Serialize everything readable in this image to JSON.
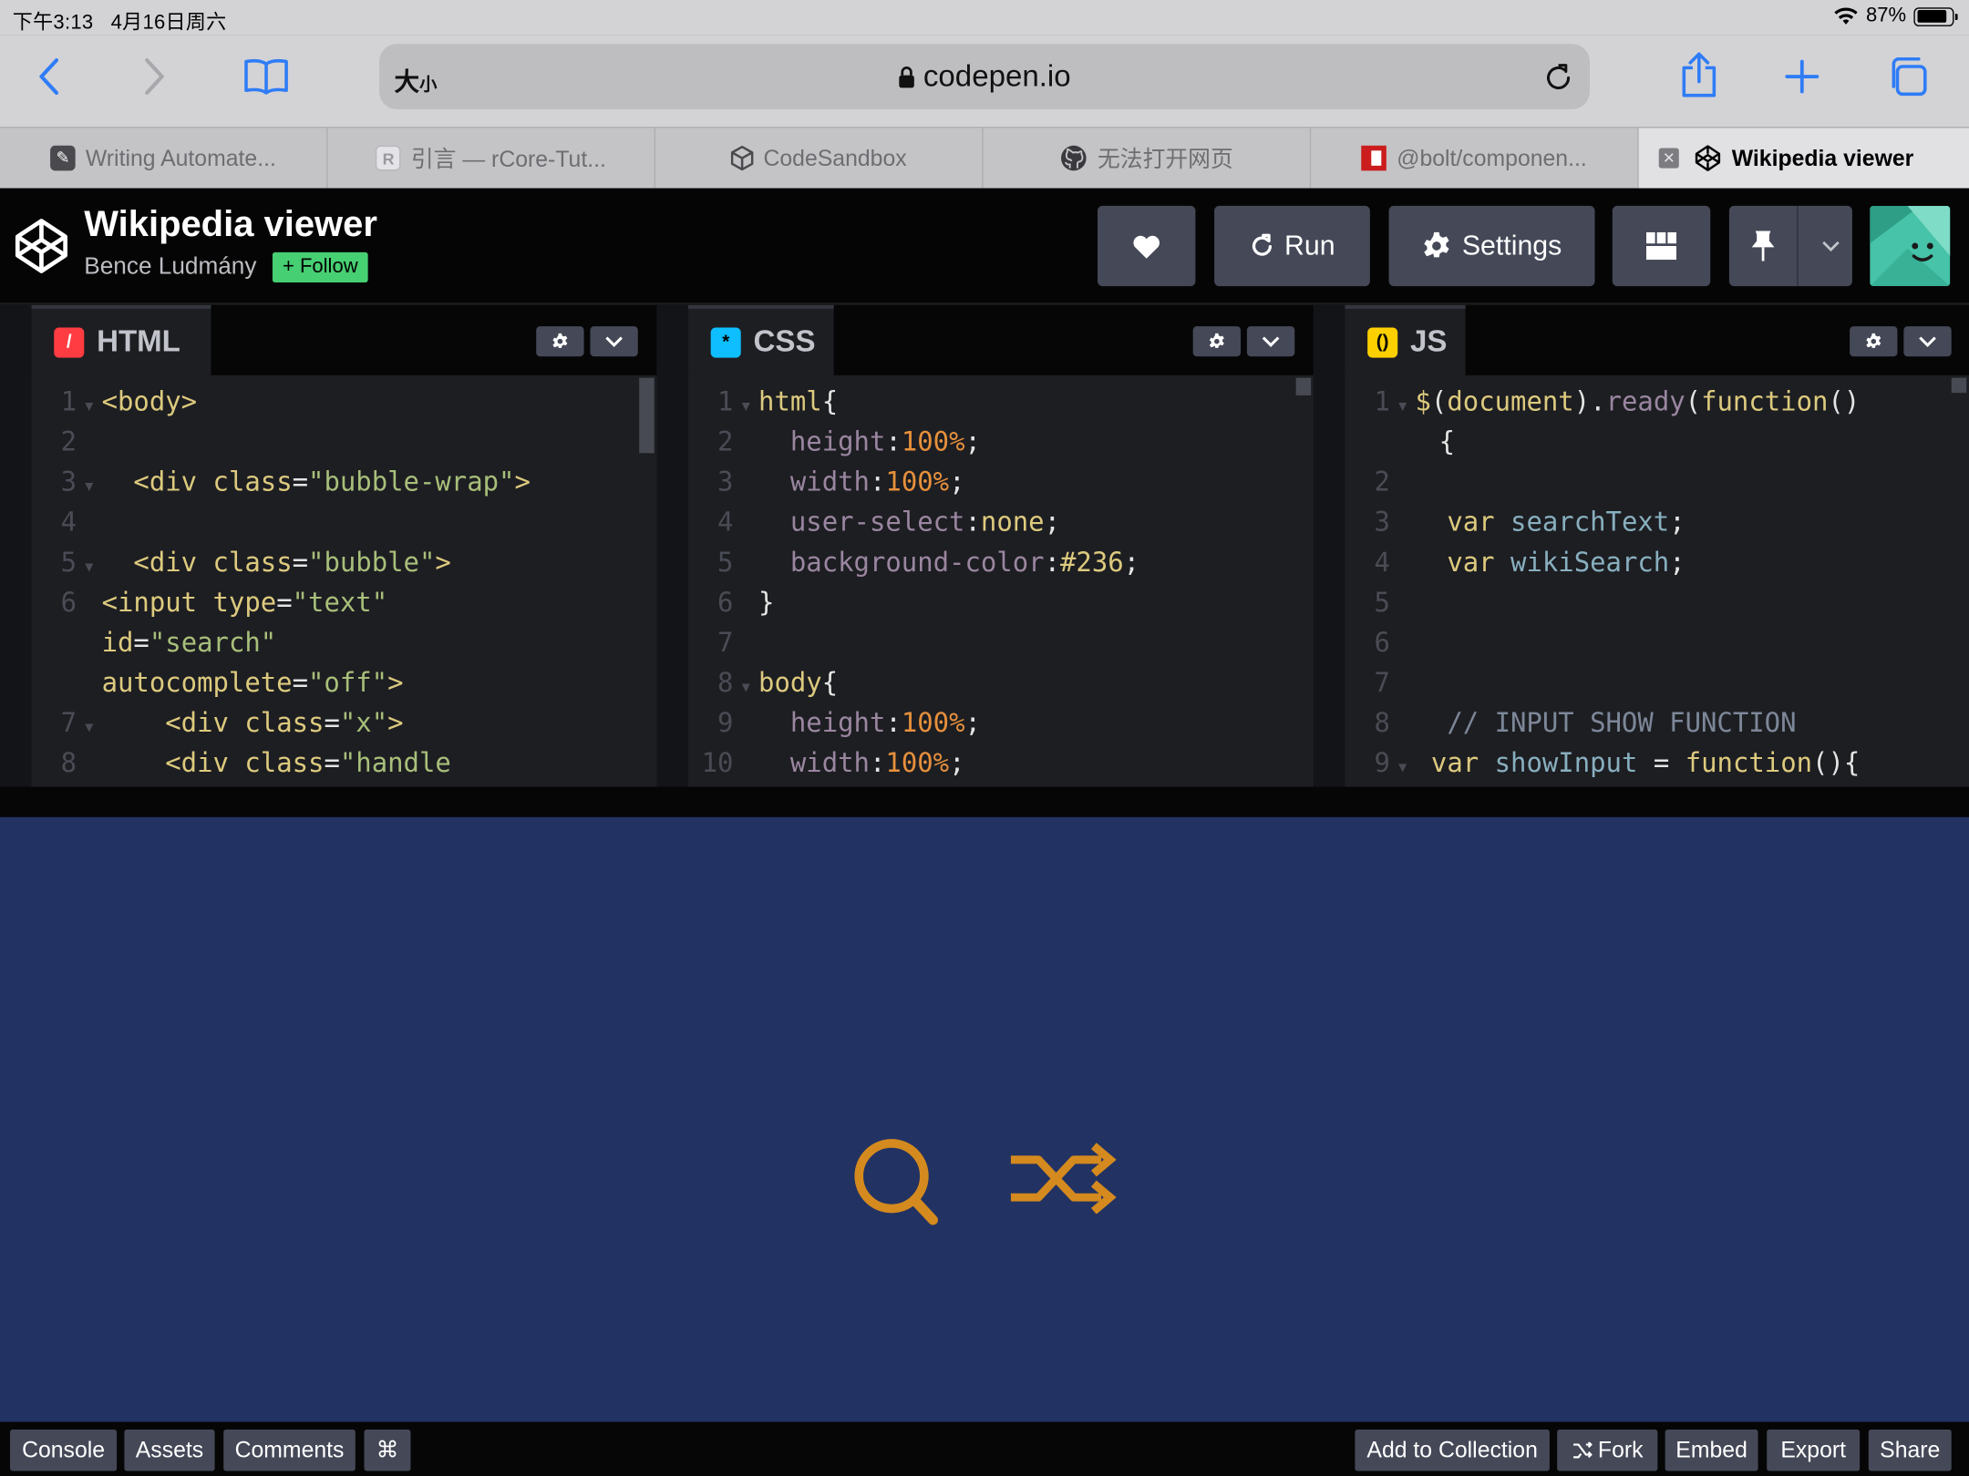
{
  "status_bar": {
    "time": "下午3:13",
    "date": "4月16日周六",
    "battery": "87%",
    "battery_level": 0.87
  },
  "safari": {
    "text_size_label": "大",
    "text_size_small": "小",
    "url": "codepen.io"
  },
  "tabs": [
    {
      "label": "Writing Automate...",
      "favicon": "book-icon"
    },
    {
      "label": "引言 — rCore-Tut...",
      "favicon": "R"
    },
    {
      "label": "CodeSandbox",
      "favicon": "cube-icon"
    },
    {
      "label": "无法打开网页",
      "favicon": "github-icon"
    },
    {
      "label": "@bolt/componen...",
      "favicon": "npm-icon"
    },
    {
      "label": "Wikipedia viewer",
      "favicon": "codepen-icon",
      "active": true
    }
  ],
  "pen": {
    "title": "Wikipedia viewer",
    "author": "Bence Ludmány",
    "follow_label": "+ Follow",
    "run_label": "Run",
    "settings_label": "Settings"
  },
  "editors": {
    "html": {
      "label": "HTML"
    },
    "css": {
      "label": "CSS"
    },
    "js": {
      "label": "JS"
    }
  },
  "bottom_left": [
    "Console",
    "Assets",
    "Comments",
    "⌘"
  ],
  "bottom_right": [
    "Add to Collection",
    "Fork",
    "Embed",
    "Export",
    "Share"
  ],
  "colors": {
    "preview_bg": "#223263",
    "icon_orange": "#d48a1e",
    "follow_green": "#47cf73"
  }
}
